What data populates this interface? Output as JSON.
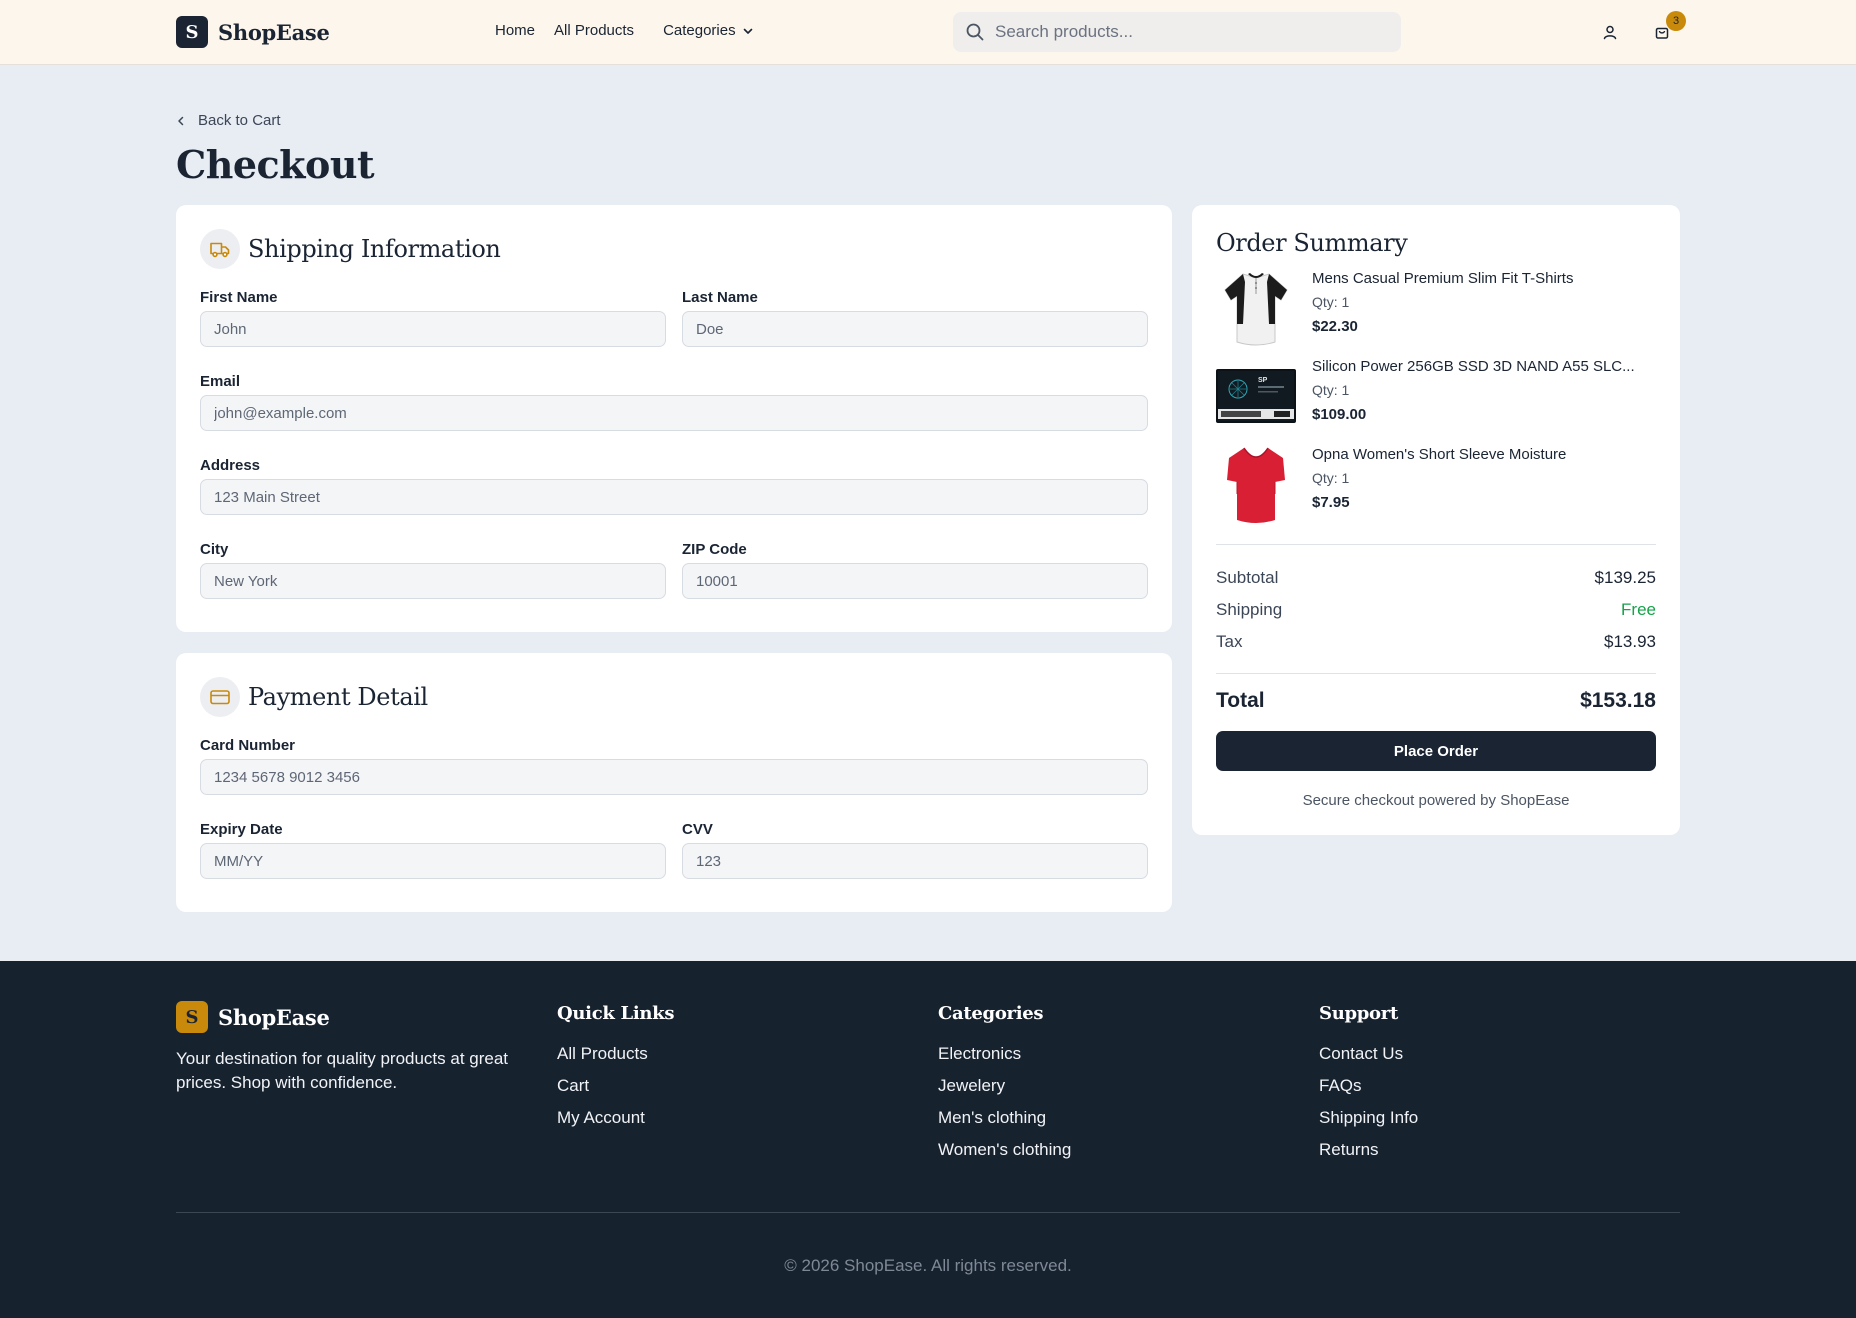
{
  "colors": {
    "brand_dark": "#1a2433",
    "accent_gold": "#c98a0b",
    "page_bg": "#e8ecf3",
    "nav_bg": "#fdf6ec",
    "footer_bg": "#17222f",
    "free_green": "#16a34a"
  },
  "nav": {
    "logo_letter": "S",
    "brand": "ShopEase",
    "links": [
      "Home",
      "All Products"
    ],
    "categories_label": "Categories",
    "search_placeholder": "Search products...",
    "cart_count": "3"
  },
  "back_label": "Back to Cart",
  "page_title": "Checkout",
  "shipping": {
    "title": "Shipping Information",
    "icon": "truck-icon",
    "first_name": {
      "label": "First Name",
      "placeholder": "John"
    },
    "last_name": {
      "label": "Last Name",
      "placeholder": "Doe"
    },
    "email": {
      "label": "Email",
      "placeholder": "john@example.com"
    },
    "address": {
      "label": "Address",
      "placeholder": "123 Main Street"
    },
    "city": {
      "label": "City",
      "placeholder": "New York"
    },
    "zip": {
      "label": "ZIP Code",
      "placeholder": "10001"
    }
  },
  "payment": {
    "title": "Payment Detail",
    "icon": "credit-card-icon",
    "card_number": {
      "label": "Card Number",
      "placeholder": "1234 5678 9012 3456"
    },
    "expiry": {
      "label": "Expiry Date",
      "placeholder": "MM/YY"
    },
    "cvv": {
      "label": "CVV",
      "placeholder": "123"
    }
  },
  "summary": {
    "title": "Order Summary",
    "items": [
      {
        "name": "Mens Casual Premium Slim Fit T-Shirts",
        "qty": "Qty: 1",
        "price": "$22.30",
        "thumb": "tshirt-raglan-icon"
      },
      {
        "name": "Silicon Power 256GB SSD 3D NAND A55 SLC...",
        "qty": "Qty: 1",
        "price": "$109.00",
        "thumb": "ssd-icon"
      },
      {
        "name": "Opna Women's Short Sleeve Moisture",
        "qty": "Qty: 1",
        "price": "$7.95",
        "thumb": "red-tshirt-icon"
      }
    ],
    "subtotal_label": "Subtotal",
    "subtotal": "$139.25",
    "shipping_label": "Shipping",
    "shipping": "Free",
    "tax_label": "Tax",
    "tax": "$13.93",
    "total_label": "Total",
    "total": "$153.18",
    "place_order": "Place Order",
    "secure_note": "Secure checkout powered by ShopEase"
  },
  "footer": {
    "logo_letter": "S",
    "brand": "ShopEase",
    "description": "Your destination for quality products at great prices. Shop with confidence.",
    "quick_links": {
      "title": "Quick Links",
      "links": [
        "All Products",
        "Cart",
        "My Account"
      ]
    },
    "categories": {
      "title": "Categories",
      "links": [
        "Electronics",
        "Jewelery",
        "Men's clothing",
        "Women's clothing"
      ]
    },
    "support": {
      "title": "Support",
      "links": [
        "Contact Us",
        "FAQs",
        "Shipping Info",
        "Returns"
      ]
    },
    "copyright": "© 2026 ShopEase. All rights reserved."
  }
}
